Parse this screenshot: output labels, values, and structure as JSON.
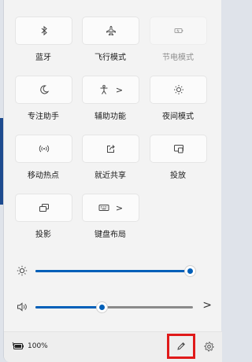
{
  "tiles": [
    {
      "label": "蓝牙",
      "icon": "bluetooth-icon",
      "disabled": false,
      "chevron": false
    },
    {
      "label": "飞行模式",
      "icon": "airplane-icon",
      "disabled": false,
      "chevron": false
    },
    {
      "label": "节电模式",
      "icon": "battery-saver-icon",
      "disabled": true,
      "chevron": false
    },
    {
      "label": "专注助手",
      "icon": "moon-icon",
      "disabled": false,
      "chevron": false
    },
    {
      "label": "辅助功能",
      "icon": "accessibility-icon",
      "disabled": false,
      "chevron": true
    },
    {
      "label": "夜间模式",
      "icon": "brightness-icon",
      "disabled": false,
      "chevron": false
    },
    {
      "label": "移动热点",
      "icon": "hotspot-icon",
      "disabled": false,
      "chevron": false
    },
    {
      "label": "就近共享",
      "icon": "share-icon",
      "disabled": false,
      "chevron": false
    },
    {
      "label": "投放",
      "icon": "cast-icon",
      "disabled": false,
      "chevron": false
    },
    {
      "label": "投影",
      "icon": "project-icon",
      "disabled": false,
      "chevron": false
    },
    {
      "label": "键盘布局",
      "icon": "keyboard-icon",
      "disabled": false,
      "chevron": true
    }
  ],
  "chevron_glyph": ">",
  "brightness": {
    "icon": "sun-icon",
    "value_percent": 100
  },
  "volume": {
    "icon": "speaker-icon",
    "value_percent": 42,
    "chevron": ">"
  },
  "footer": {
    "battery_icon": "battery-charging-icon",
    "battery_text": "100%",
    "edit_icon": "pencil-icon",
    "settings_icon": "gear-icon"
  },
  "colors": {
    "accent": "#005fb8",
    "highlight_box": "#e01a1a"
  }
}
